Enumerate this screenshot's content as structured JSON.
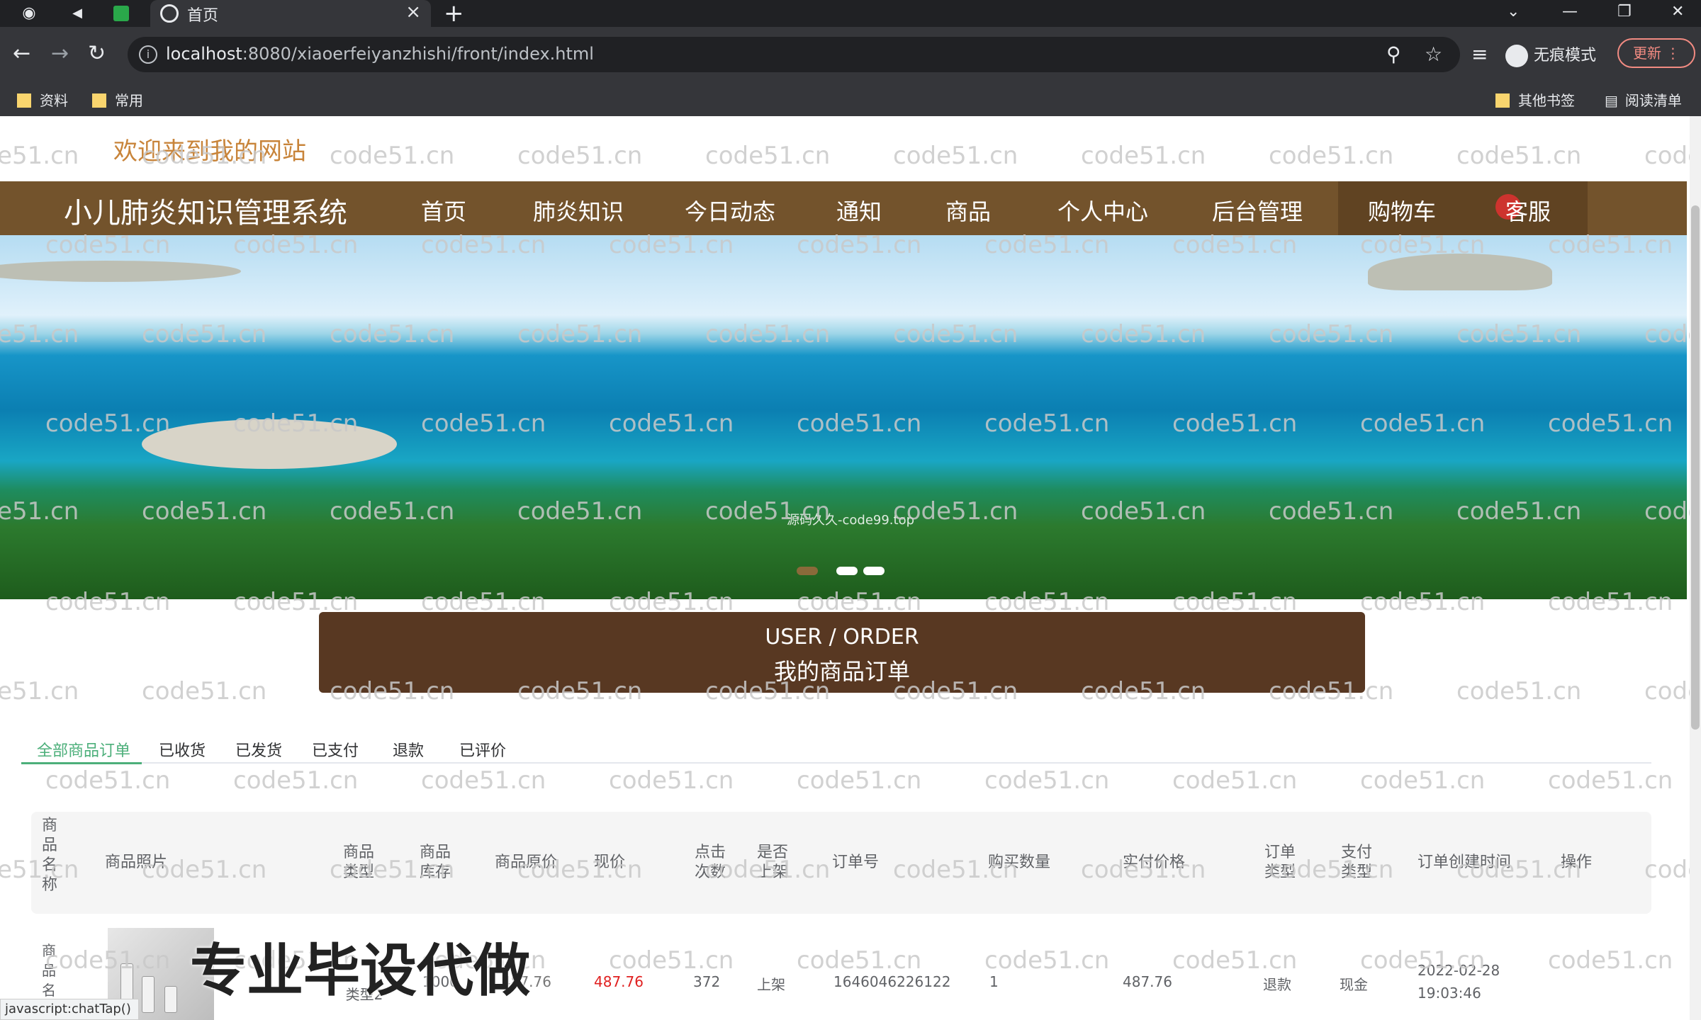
{
  "browser": {
    "tab_title": "首页",
    "url_host": "localhost",
    "url_path": ":8080/xiaoerfeiyanzhishi/front/index.html",
    "incognito_label": "无痕模式",
    "update_label": "更新",
    "bookmarks": [
      "资料",
      "常用"
    ],
    "other_bookmarks": "其他书签",
    "reading_list": "阅读清单",
    "status_text": "javascript:chatTap()"
  },
  "watermark": "code51.cn",
  "header": {
    "welcome": "欢迎来到我的网站",
    "brand": "小儿肺炎知识管理系统",
    "nav": [
      "首页",
      "肺炎知识",
      "今日动态",
      "通知",
      "商品",
      "个人中心",
      "后台管理",
      "购物车",
      "客服"
    ]
  },
  "banner": {
    "caption": "源码久久-code99.top"
  },
  "order": {
    "title_en": "USER / ORDER",
    "title_cn": "我的商品订单",
    "tabs": [
      "全部商品订单",
      "已收货",
      "已发货",
      "已支付",
      "退款",
      "已评价"
    ],
    "columns": [
      "商品名称",
      "商品照片",
      "商品类型",
      "商品库存",
      "商品原价",
      "现价",
      "点击次数",
      "是否上架",
      "订单号",
      "购买数量",
      "实付价格",
      "订单类型",
      "支付类型",
      "订单创建时间",
      "操作"
    ],
    "row": {
      "name": "商品名",
      "type": "类型2",
      "stock": "1000",
      "price": "487.76",
      "clicks": "372",
      "on_shelf": "上架",
      "order_no": "1646046226122",
      "qty": "1",
      "paid": "487.76",
      "order_type": "退款",
      "pay_type": "现金",
      "date": "2022-02-28",
      "time": "19:03:46"
    }
  },
  "promo": "专业毕设代做",
  "colors": {
    "nav_bg": "#73532c",
    "order_bar": "#583822",
    "accent_green": "#4caf7a",
    "price_red": "#e02020",
    "welcome": "#c8843a"
  }
}
